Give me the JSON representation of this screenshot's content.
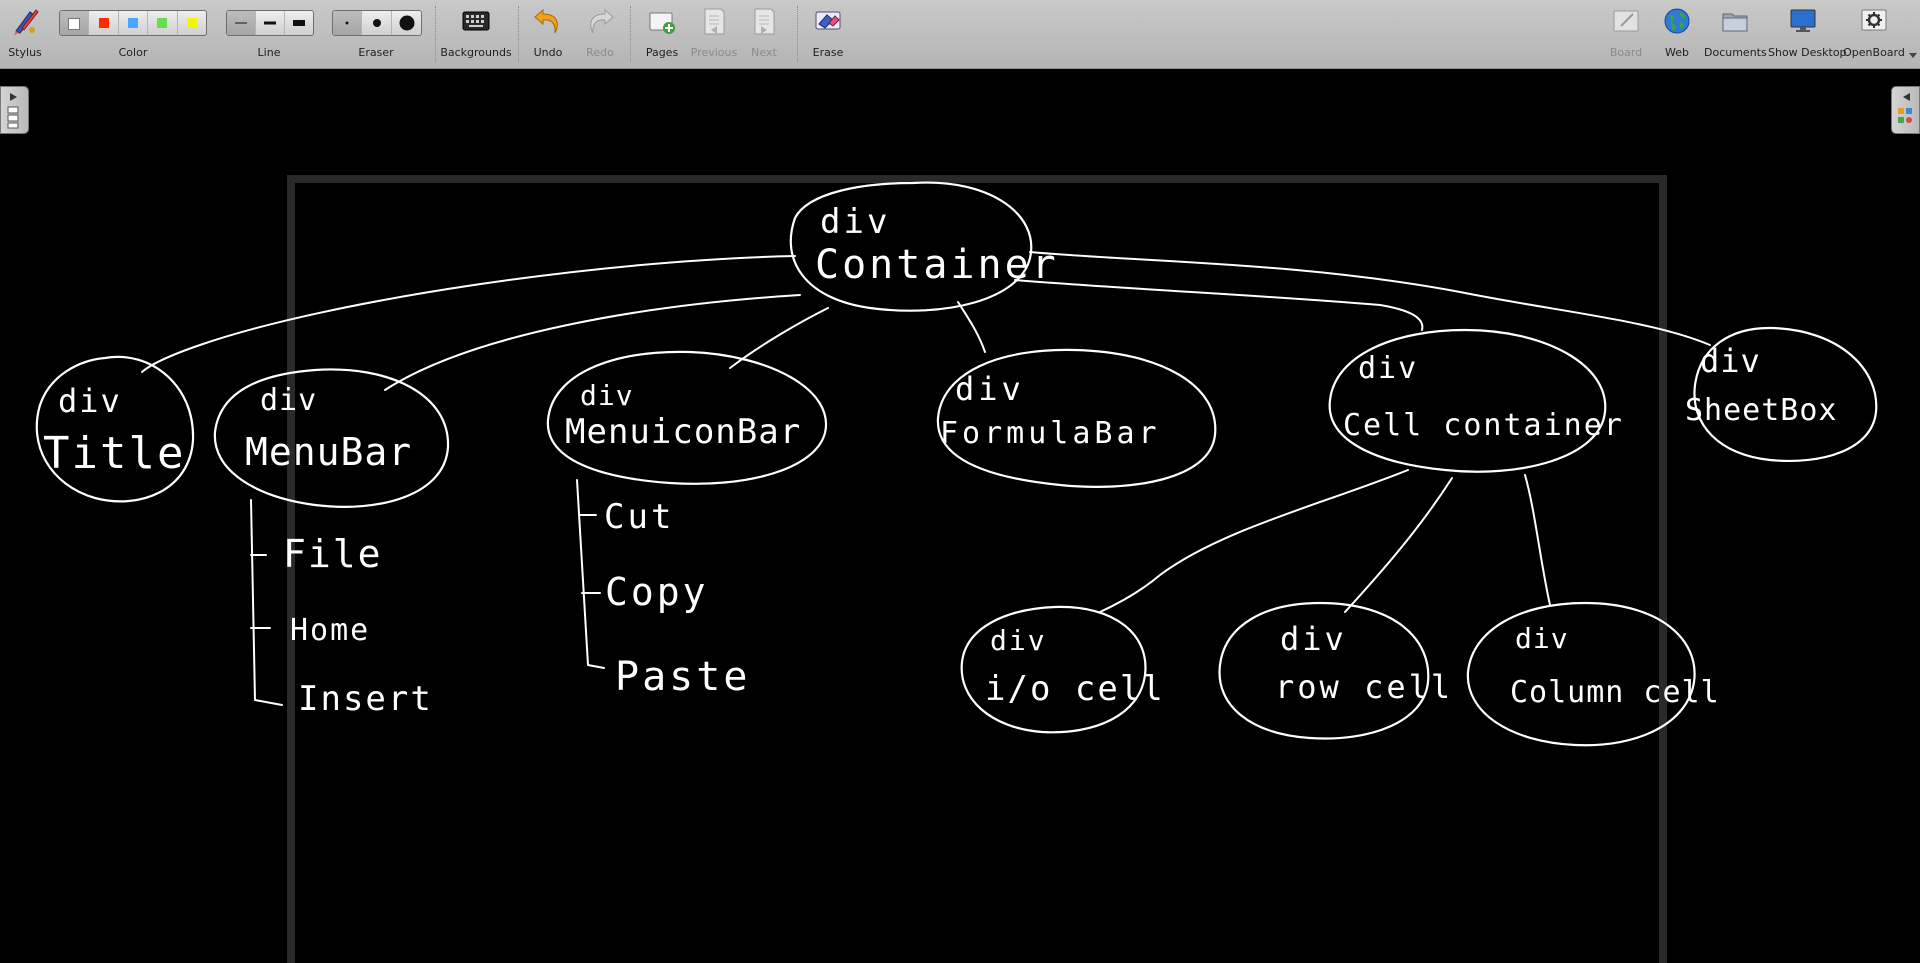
{
  "toolbar": {
    "stylus_label": "Stylus",
    "color_label": "Color",
    "line_label": "Line",
    "eraser_label": "Eraser",
    "backgrounds_label": "Backgrounds",
    "undo_label": "Undo",
    "redo_label": "Redo",
    "pages_label": "Pages",
    "previous_label": "Previous",
    "next_label": "Next",
    "erase_label": "Erase",
    "board_label": "Board",
    "web_label": "Web",
    "documents_label": "Documents",
    "show_desktop_label": "Show Desktop",
    "openboard_label": "OpenBoard",
    "colors": [
      "#ffffff",
      "#ff2a00",
      "#4aa6ff",
      "#66e04a",
      "#f4f400"
    ],
    "selected_color_index": 0,
    "selected_line_index": 0,
    "selected_eraser_index": 0,
    "disabled": [
      "redo",
      "previous",
      "next",
      "board"
    ]
  },
  "board": {
    "background": "#000000",
    "ink_color": "#ffffff",
    "handwriting": {
      "root": [
        "div",
        "Container"
      ],
      "children": [
        [
          "div",
          "Title"
        ],
        [
          "div",
          "MenuBar"
        ],
        [
          "div",
          "MenuiconBar"
        ],
        [
          "div",
          "FormulaBar"
        ],
        [
          "div",
          "Cell container"
        ],
        [
          "div",
          "SheetBox"
        ]
      ],
      "menubar_items": [
        "File",
        "Home",
        "Insert"
      ],
      "menuiconbar_items": [
        "Cut",
        "Copy",
        "Paste"
      ],
      "cell_container_children": [
        [
          "div",
          "i/o cell"
        ],
        [
          "div",
          "row cell"
        ],
        [
          "div",
          "Column cell"
        ]
      ]
    }
  }
}
